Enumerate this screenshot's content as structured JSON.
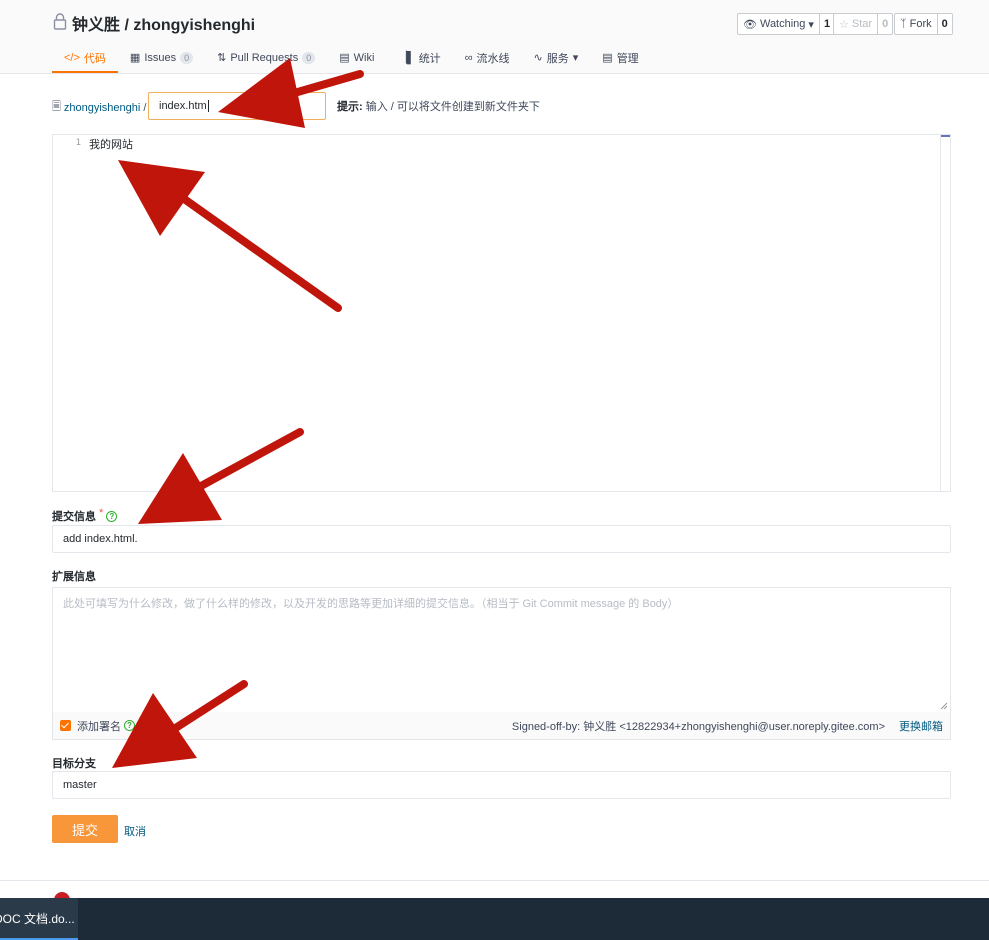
{
  "header": {
    "repo_title": "钟义胜 / zhongyishenghi",
    "watching_label": "Watching",
    "watching_count": "1",
    "star_label": "Star",
    "star_count": "0",
    "fork_label": "Fork",
    "fork_count": "0"
  },
  "tabs": [
    {
      "label": "代码",
      "badge": null
    },
    {
      "label": "Issues",
      "badge": "0"
    },
    {
      "label": "Pull Requests",
      "badge": "0"
    },
    {
      "label": "Wiki",
      "badge": null
    },
    {
      "label": "统计",
      "badge": null
    },
    {
      "label": "流水线",
      "badge": null
    },
    {
      "label": "服务",
      "badge": null
    },
    {
      "label": "管理",
      "badge": null
    }
  ],
  "path": {
    "repo_link": "zhongyishenghi",
    "separator": "/",
    "filename": "index.htm",
    "hint_bold": "提示:",
    "hint_text": "输入 / 可以将文件创建到新文件夹下"
  },
  "editor": {
    "line_number": "1",
    "line_text": "我的网站"
  },
  "commit": {
    "label": "提交信息",
    "required_mark": "*",
    "value": "add index.html."
  },
  "extended": {
    "label": "扩展信息",
    "placeholder": "此处可填写为什么修改，做了什么样的修改，以及开发的思路等更加详细的提交信息。（相当于 Git Commit message 的 Body）",
    "signoff_label": "添加署名",
    "signed_by": "Signed-off-by: 钟义胜 <12822934+zhongyishenghi@user.noreply.gitee.com>",
    "change_email": "更换邮箱"
  },
  "branch": {
    "label": "目标分支",
    "value": "master"
  },
  "actions": {
    "submit": "提交",
    "cancel": "取消"
  },
  "taskbar": {
    "item": "DOC 文档.do..."
  },
  "colors": {
    "accent": "#fe7300",
    "submit": "#f8963a",
    "link": "#005980",
    "annotation_arrow": "#c0150a"
  }
}
